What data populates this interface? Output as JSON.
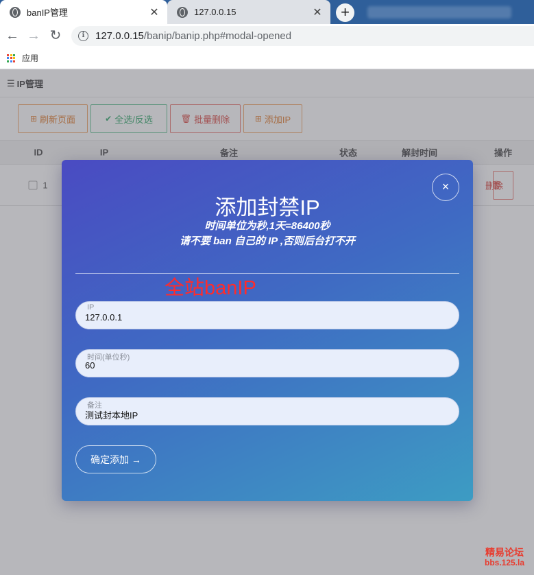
{
  "browser": {
    "tabs": [
      {
        "title": "banIP管理",
        "close": "✕"
      },
      {
        "title": "127.0.0.15",
        "close": "✕"
      }
    ],
    "new_tab": "+",
    "nav": {
      "back": "←",
      "forward": "→",
      "reload": "↻"
    },
    "url": {
      "host": "127.0.0.15",
      "path": "/banip/banip.php#modal-opened"
    },
    "bookmarks": [
      {
        "label": "应用"
      }
    ]
  },
  "page": {
    "header": {
      "title": "IP管理"
    },
    "toolbar": [
      {
        "icon": "⊞",
        "label": "刷新页面"
      },
      {
        "icon": "✔",
        "label": "全选/反选"
      },
      {
        "icon": "🗑",
        "label": "批量删除"
      },
      {
        "icon": "⊞",
        "label": "添加IP"
      }
    ],
    "table": {
      "columns": [
        "ID",
        "IP",
        "备注",
        "状态",
        "解封时间",
        "操作"
      ],
      "rows": [
        {
          "id": "1",
          "delete_icon": "🗑",
          "delete_label": "删除"
        }
      ]
    }
  },
  "modal": {
    "close": "×",
    "title": "添加封禁IP",
    "subtitle_line1": "时间单位为秒,1天=86400秒",
    "subtitle_line2": "请不要 ban 自己的 IP ,否则后台打不开",
    "banner": "全站banIP",
    "fields": [
      {
        "label": "IP",
        "value": "127.0.0.1"
      },
      {
        "label": "时间(单位秒)",
        "value": "60"
      },
      {
        "label": "备注",
        "value": "测试封本地IP"
      }
    ],
    "submit": "确定添加 →"
  },
  "watermark": {
    "line1": "精易论坛",
    "line2": "bbs.125.la"
  },
  "colors": {
    "modal_gradient_start": "#4a4bc2",
    "modal_gradient_end": "#3d9cc3",
    "banner": "#ff2b2b",
    "tab_strip": "#2f5f9a"
  }
}
